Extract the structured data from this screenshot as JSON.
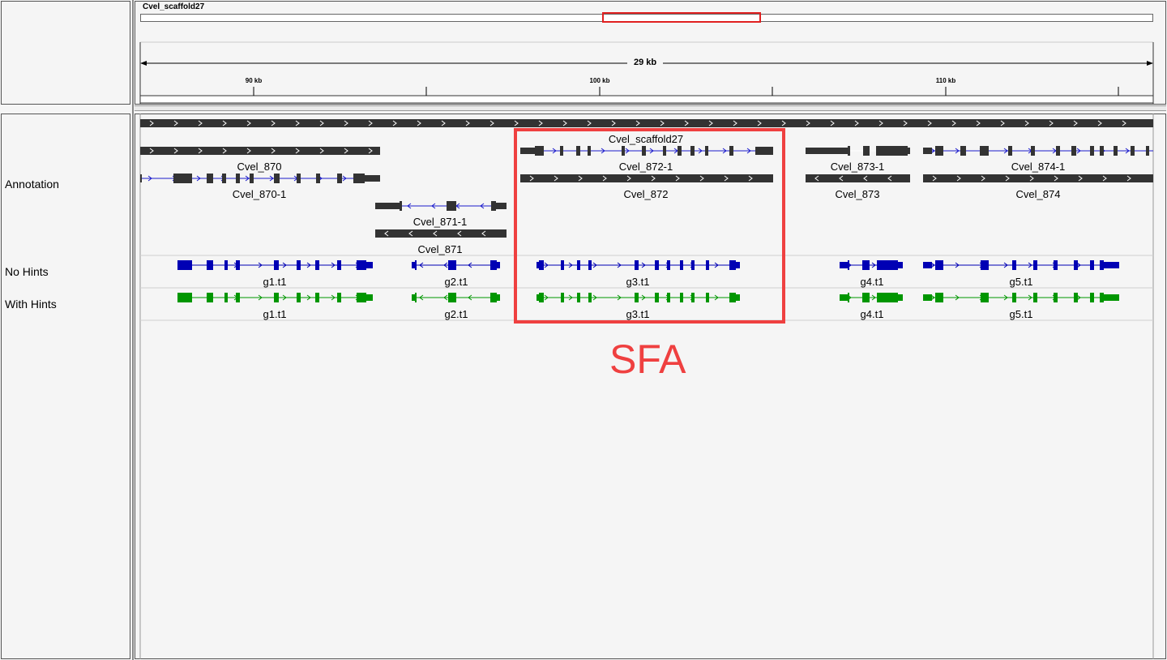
{
  "header": {
    "chromosome": "Cvel_scaffold27",
    "span": "29 kb",
    "ticks": [
      "90 kb",
      "100 kb",
      "110 kb"
    ]
  },
  "tracks": {
    "annotation": "Annotation",
    "no_hints": "No Hints",
    "with_hints": "With Hints"
  },
  "features": {
    "scaffold": "Cvel_scaffold27",
    "cvel_870": "Cvel_870",
    "cvel_870_1": "Cvel_870-1",
    "cvel_871_1": "Cvel_871-1",
    "cvel_871": "Cvel_871",
    "cvel_872_1": "Cvel_872-1",
    "cvel_872": "Cvel_872",
    "cvel_873_1": "Cvel_873-1",
    "cvel_873": "Cvel_873",
    "cvel_874_1": "Cvel_874-1",
    "cvel_874": "Cvel_874",
    "g1": "g1.t1",
    "g2": "g2.t1",
    "g3": "g3.t1",
    "g4": "g4.t1",
    "g5": "g5.t1"
  },
  "annotation_note": "SFA",
  "colors": {
    "annotation": "#333333",
    "no_hints": "#0000b4",
    "with_hints": "#009600",
    "highlight": "#ef4040"
  }
}
